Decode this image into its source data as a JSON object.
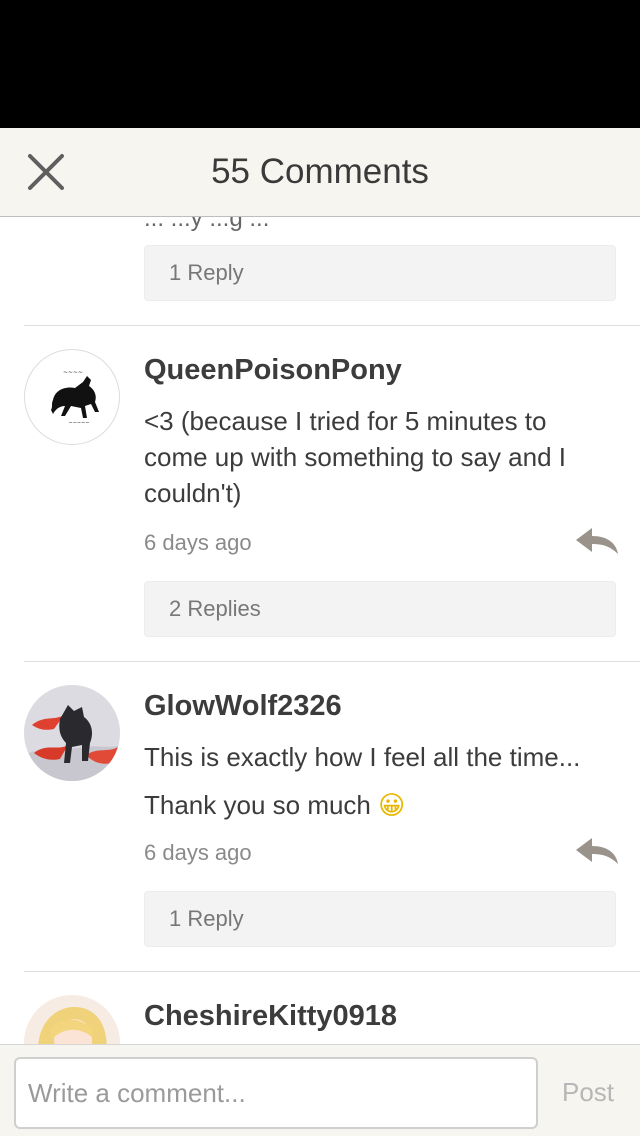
{
  "header": {
    "title": "55 Comments",
    "close_icon": "close-icon"
  },
  "comments": [
    {
      "partial_text": "... ...y ...g ...",
      "replies_label": "1 Reply"
    },
    {
      "username": "QueenPoisonPony",
      "text": "<3 (because I tried for 5 minutes to come up with something to say and I couldn't)",
      "timestamp": "6 days ago",
      "replies_label": "2 Replies",
      "avatar": "black-horse-avatar"
    },
    {
      "username": "GlowWolf2326",
      "text_line1": "This is exactly how I feel all the time...",
      "text_line2": "Thank you so much",
      "emoji": "😀",
      "timestamp": "6 days ago",
      "replies_label": "1 Reply",
      "avatar": "wolf-avatar"
    },
    {
      "username": "CheshireKitty0918",
      "avatar": "anime-girl-avatar"
    }
  ],
  "footer": {
    "placeholder": "Write a comment...",
    "post_label": "Post"
  },
  "colors": {
    "header_bg": "#f6f5ef",
    "reply_icon": "#9a938b",
    "reply_button_bg": "#f3f3f3"
  }
}
